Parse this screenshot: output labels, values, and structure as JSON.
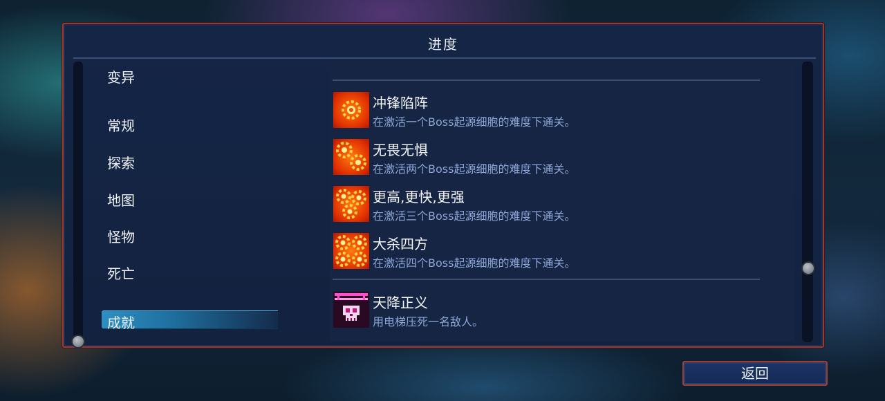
{
  "header": {
    "title": "进度"
  },
  "categories": [
    {
      "label": "变异",
      "selected": false
    },
    {
      "label": "常规",
      "selected": false
    },
    {
      "label": "探索",
      "selected": false
    },
    {
      "label": "地图",
      "selected": false
    },
    {
      "label": "怪物",
      "selected": false
    },
    {
      "label": "死亡",
      "selected": false
    },
    {
      "label": "成就",
      "selected": true
    }
  ],
  "achievements": [
    {
      "name": "冲锋陷阵",
      "description": "在激活一个Boss起源细胞的难度下通关。",
      "icon": "boss-cell-1-icon"
    },
    {
      "name": "无畏无惧",
      "description": "在激活两个Boss起源细胞的难度下通关。",
      "icon": "boss-cell-2-icon"
    },
    {
      "name": "更高,更快,更强",
      "description": "在激活三个Boss起源细胞的难度下通关。",
      "icon": "boss-cell-3-icon"
    },
    {
      "name": "大杀四方",
      "description": "在激活四个Boss起源细胞的难度下通关。",
      "icon": "boss-cell-4-icon"
    },
    {
      "name": "天降正义",
      "description": "用电梯压死一名敌人。",
      "icon": "elevator-skull-icon"
    }
  ],
  "footer": {
    "back_label": "返回"
  },
  "colors": {
    "accent_border": "#9a3a30",
    "panel_bg": "#152546",
    "selected_tab": "#2d8fc2",
    "description_text": "#8ea6d6"
  }
}
